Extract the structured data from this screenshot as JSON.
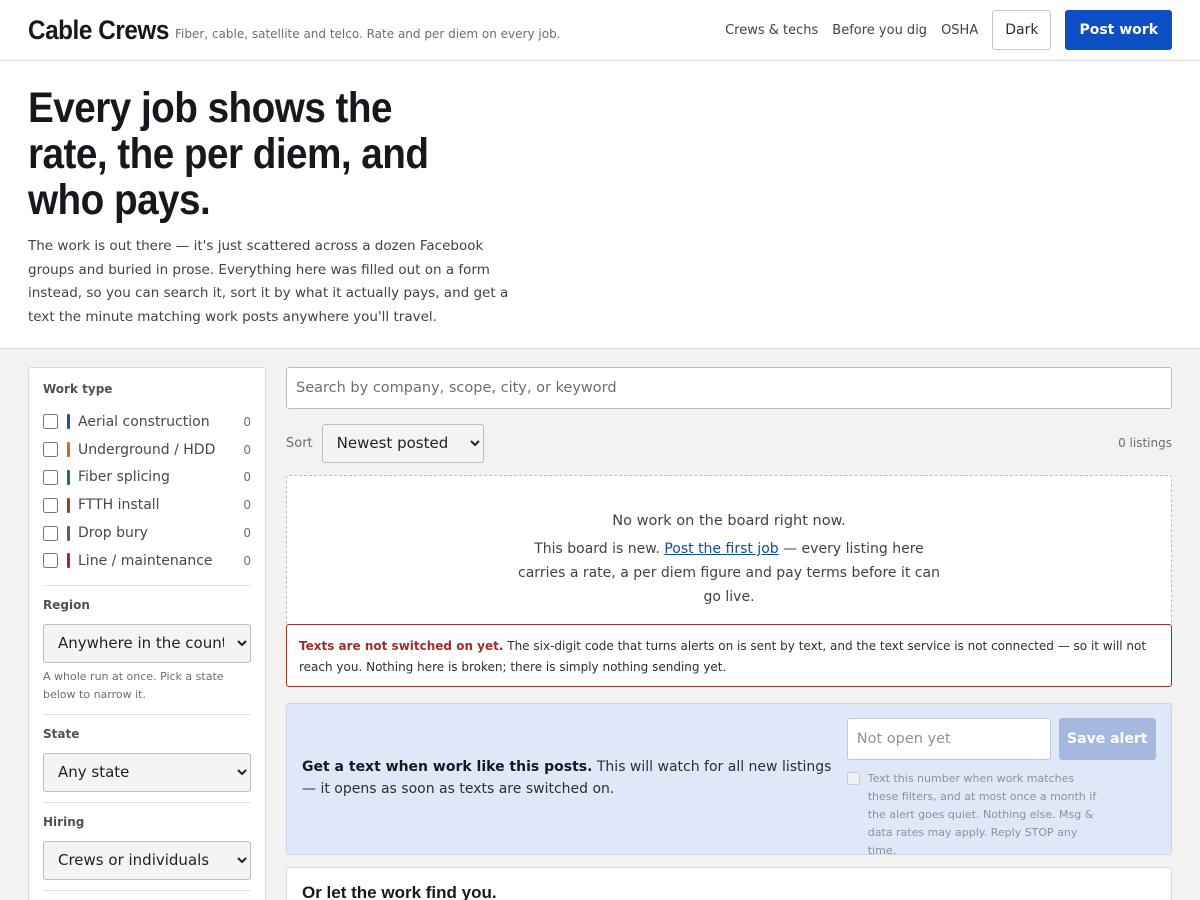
{
  "header": {
    "brand": "Cable Crews",
    "tagline": "Fiber, cable, satellite and telco. Rate and per diem on every job.",
    "nav": [
      "Crews & techs",
      "Before you dig",
      "OSHA"
    ],
    "dark_label": "Dark",
    "post_label": "Post work"
  },
  "hero": {
    "title": "Every job shows the rate, the per diem, and who pays.",
    "body": "The work is out there — it's just scattered across a dozen Facebook groups and buried in prose. Everything here was filled out on a form instead, so you can search it, sort it by what it actually pays, and get a text the minute matching work posts anywhere you'll travel."
  },
  "sidebar": {
    "work_type_heading": "Work type",
    "work_types": [
      {
        "label": "Aerial construction",
        "count": "0",
        "color": "#1f4fb8"
      },
      {
        "label": "Underground / HDD",
        "count": "0",
        "color": "#d9641a"
      },
      {
        "label": "Fiber splicing",
        "count": "0",
        "color": "#1f7a3a"
      },
      {
        "label": "FTTH install",
        "count": "0",
        "color": "#8a4a1c"
      },
      {
        "label": "Drop bury",
        "count": "0",
        "color": "#5a5f66"
      },
      {
        "label": "Line / maintenance",
        "count": "0",
        "color": "#b3242b"
      }
    ],
    "region_heading": "Region",
    "region_value": "Anywhere in the country",
    "region_help": "A whole run at once. Pick a state below to narrow it.",
    "state_heading": "State",
    "state_value": "Any state",
    "hiring_heading": "Hiring",
    "hiring_value": "Crews or individuals"
  },
  "search": {
    "placeholder": "Search by company, scope, city, or keyword"
  },
  "sort": {
    "label": "Sort",
    "value": "Newest posted",
    "count": "0 listings"
  },
  "empty": {
    "title": "No work on the board right now.",
    "prefix": "This board is new.",
    "link": "Post the first job",
    "suffix": "— every listing here carries a rate, a per diem figure and pay terms before it can go live."
  },
  "warning": {
    "title": "Texts are not switched on yet.",
    "body": "The six-digit code that turns alerts on is sent by text, and the text service is not connected — so it will not reach you. Nothing here is broken; there is simply nothing sending yet."
  },
  "alert": {
    "title": "Get a text when work like this posts.",
    "body": "This will watch for all new listings — it opens as soon as texts are switched on.",
    "phone_placeholder": "Not open yet",
    "save_label": "Save alert",
    "consent": "Text this number when work matches these filters, and at most once a month if the alert goes quiet. Nothing else. Msg & data rates may apply. Reply STOP any time."
  },
  "find": {
    "title": "Or let the work find you."
  }
}
